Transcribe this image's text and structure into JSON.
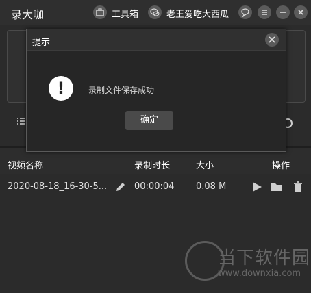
{
  "app": {
    "title": "录大咖"
  },
  "header": {
    "toolbox_label": "工具箱",
    "user_label": "老王爱吃大西瓜"
  },
  "table": {
    "headers": {
      "name": "视频名称",
      "duration": "录制时长",
      "size": "大小",
      "actions": "操作"
    },
    "rows": [
      {
        "name": "2020-08-18_16-30-5...",
        "duration": "00:00:04",
        "size": "0.08 M"
      }
    ]
  },
  "dialog": {
    "title": "提示",
    "message": "录制文件保存成功",
    "ok_label": "确定"
  },
  "watermark": {
    "brand": "当下软件园",
    "url": "www.downxia.com"
  },
  "colors": {
    "background": "#2b2b2b",
    "dialog_bg": "#262626",
    "button_bg": "#4a4a4a",
    "text": "#ffffff"
  },
  "icons": {
    "toolbox": "toolbox-icon",
    "user": "wechat-icon",
    "feedback": "chat-bubble-icon",
    "menu": "menu-icon",
    "minimize": "minimize-icon",
    "close": "close-icon",
    "edit": "pencil-icon",
    "play": "play-icon",
    "folder": "folder-icon",
    "delete": "trash-icon",
    "warning": "exclamation-icon"
  }
}
